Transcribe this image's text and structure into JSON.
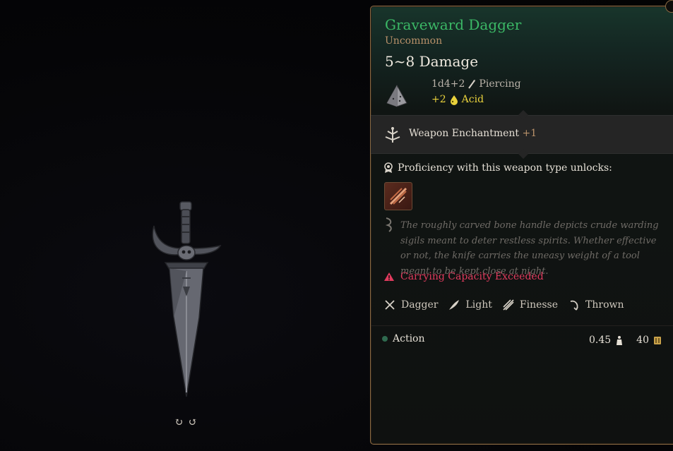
{
  "item": {
    "name": "Graveward Dagger",
    "rarity": "Uncommon",
    "damage": "5~8 Damage",
    "dice": "1d4+2",
    "damage_type": "Piercing",
    "bonus_amount": "+2",
    "bonus_type": "Acid"
  },
  "enchantment": {
    "label": "Weapon Enchantment",
    "value": "+1"
  },
  "proficiency": {
    "text": "Proficiency with this weapon type unlocks:"
  },
  "description": "The roughly carved bone handle depicts crude warding sigils meant to deter restless spirits. Whether effective or not, the knife carries the uneasy weight of a tool meant to be kept close at night.",
  "warning": "Carrying Capacity Exceeded",
  "traits": [
    {
      "label": "Dagger",
      "icon": "crossed-daggers-icon"
    },
    {
      "label": "Light",
      "icon": "feather-icon"
    },
    {
      "label": "Finesse",
      "icon": "slash-icon"
    },
    {
      "label": "Thrown",
      "icon": "throw-arc-icon"
    }
  ],
  "footer": {
    "action": "Action",
    "weight": "0.45",
    "value": "40"
  },
  "colors": {
    "title": "#3bb866",
    "rarity": "#b9916a",
    "acid": "#e9d23c",
    "warning": "#e03b5e",
    "panel_border": "#8a6a43"
  },
  "controls": {
    "rotate_left": "↻",
    "rotate_right": "↺"
  }
}
